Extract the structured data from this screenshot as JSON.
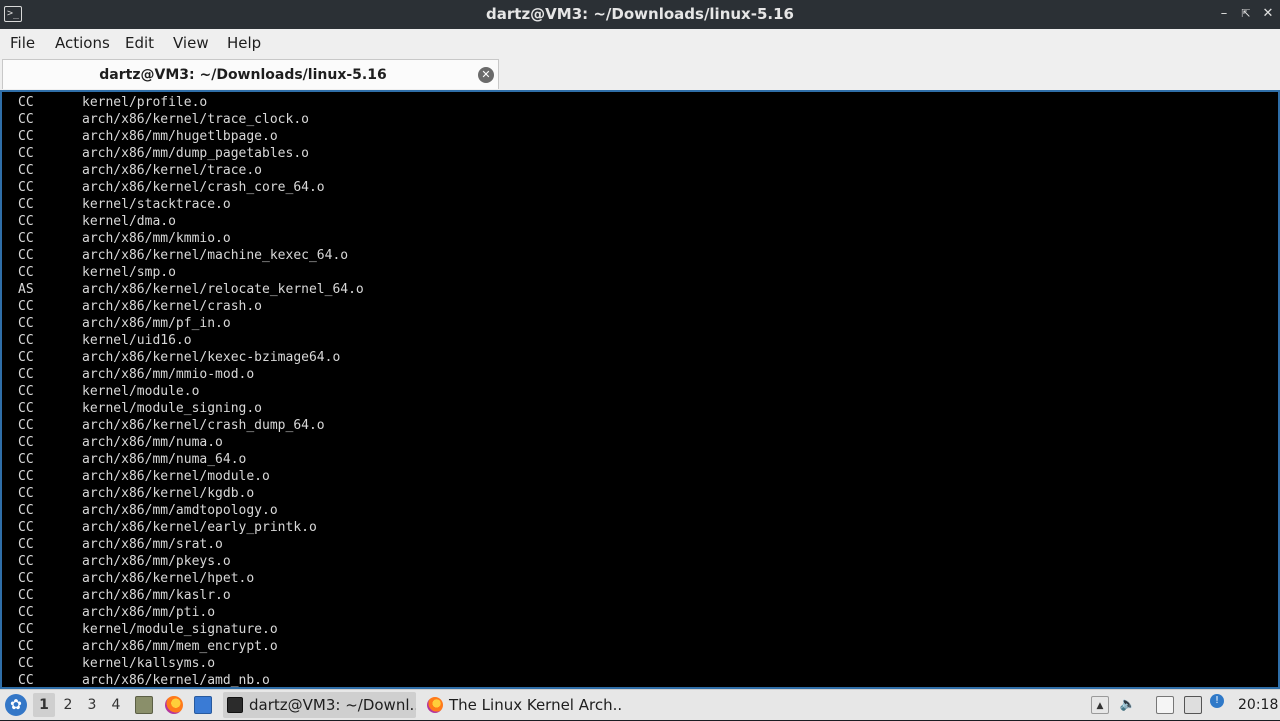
{
  "window": {
    "title": "dartz@VM3: ~/Downloads/linux-5.16"
  },
  "menubar": {
    "items": [
      "File",
      "Actions",
      "Edit",
      "View",
      "Help"
    ]
  },
  "tab": {
    "label": "dartz@VM3: ~/Downloads/linux-5.16"
  },
  "terminal": {
    "lines": [
      {
        "kind": "CC",
        "path": "kernel/profile.o"
      },
      {
        "kind": "CC",
        "path": "arch/x86/kernel/trace_clock.o"
      },
      {
        "kind": "CC",
        "path": "arch/x86/mm/hugetlbpage.o"
      },
      {
        "kind": "CC",
        "path": "arch/x86/mm/dump_pagetables.o"
      },
      {
        "kind": "CC",
        "path": "arch/x86/kernel/trace.o"
      },
      {
        "kind": "CC",
        "path": "arch/x86/kernel/crash_core_64.o"
      },
      {
        "kind": "CC",
        "path": "kernel/stacktrace.o"
      },
      {
        "kind": "CC",
        "path": "kernel/dma.o"
      },
      {
        "kind": "CC",
        "path": "arch/x86/mm/kmmio.o"
      },
      {
        "kind": "CC",
        "path": "arch/x86/kernel/machine_kexec_64.o"
      },
      {
        "kind": "CC",
        "path": "kernel/smp.o"
      },
      {
        "kind": "AS",
        "path": "arch/x86/kernel/relocate_kernel_64.o"
      },
      {
        "kind": "CC",
        "path": "arch/x86/kernel/crash.o"
      },
      {
        "kind": "CC",
        "path": "arch/x86/mm/pf_in.o"
      },
      {
        "kind": "CC",
        "path": "kernel/uid16.o"
      },
      {
        "kind": "CC",
        "path": "arch/x86/kernel/kexec-bzimage64.o"
      },
      {
        "kind": "CC",
        "path": "arch/x86/mm/mmio-mod.o"
      },
      {
        "kind": "CC",
        "path": "kernel/module.o"
      },
      {
        "kind": "CC",
        "path": "kernel/module_signing.o"
      },
      {
        "kind": "CC",
        "path": "arch/x86/kernel/crash_dump_64.o"
      },
      {
        "kind": "CC",
        "path": "arch/x86/mm/numa.o"
      },
      {
        "kind": "CC",
        "path": "arch/x86/mm/numa_64.o"
      },
      {
        "kind": "CC",
        "path": "arch/x86/kernel/module.o"
      },
      {
        "kind": "CC",
        "path": "arch/x86/kernel/kgdb.o"
      },
      {
        "kind": "CC",
        "path": "arch/x86/mm/amdtopology.o"
      },
      {
        "kind": "CC",
        "path": "arch/x86/kernel/early_printk.o"
      },
      {
        "kind": "CC",
        "path": "arch/x86/mm/srat.o"
      },
      {
        "kind": "CC",
        "path": "arch/x86/mm/pkeys.o"
      },
      {
        "kind": "CC",
        "path": "arch/x86/kernel/hpet.o"
      },
      {
        "kind": "CC",
        "path": "arch/x86/mm/kaslr.o"
      },
      {
        "kind": "CC",
        "path": "arch/x86/mm/pti.o"
      },
      {
        "kind": "CC",
        "path": "kernel/module_signature.o"
      },
      {
        "kind": "CC",
        "path": "arch/x86/mm/mem_encrypt.o"
      },
      {
        "kind": "CC",
        "path": "kernel/kallsyms.o"
      },
      {
        "kind": "CC",
        "path": "arch/x86/kernel/amd_nb.o"
      }
    ]
  },
  "taskbar": {
    "workspaces": [
      "1",
      "2",
      "3",
      "4"
    ],
    "active_workspace": "1",
    "tasks": [
      {
        "label": "dartz@VM3: ~/Downl...",
        "icon": "terminal-icon",
        "active": true
      },
      {
        "label": "The Linux Kernel Arch...",
        "icon": "firefox-icon",
        "active": false
      }
    ],
    "clock": "20:18"
  },
  "colors": {
    "terminal_bg": "#000000",
    "terminal_text": "#d8d8d8",
    "terminal_border": "#2f6ea8",
    "titlebar_bg": "#2b3035",
    "menubar_bg": "#efefef",
    "taskbar_bg": "#e7e7e7"
  }
}
